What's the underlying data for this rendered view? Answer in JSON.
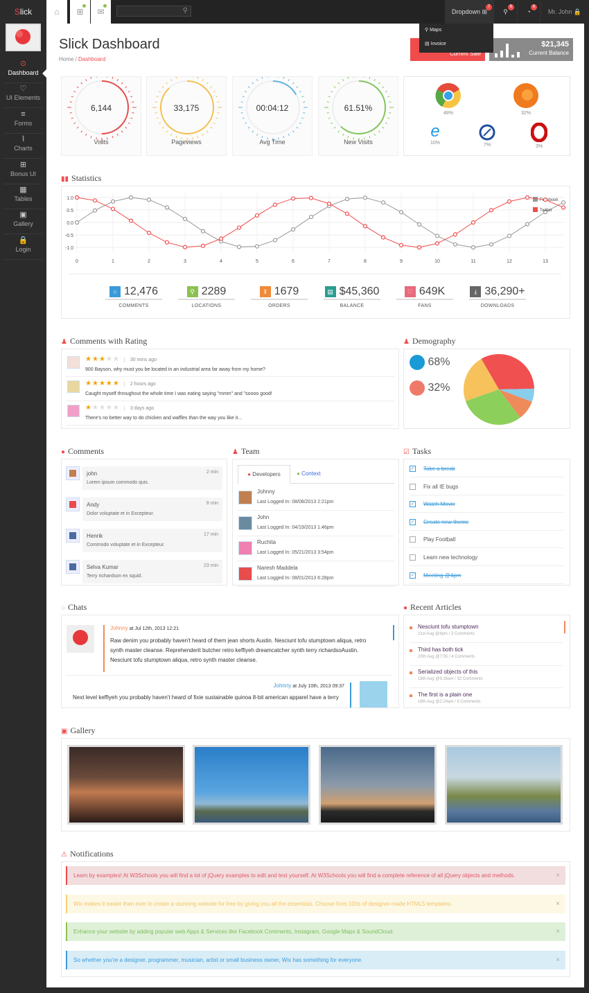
{
  "brand": {
    "first": "S",
    "rest": "lick"
  },
  "sidebar": {
    "items": [
      {
        "label": "Dashboard",
        "icon": "dashboard-icon",
        "glyph": "⊙"
      },
      {
        "label": "UI Elements",
        "icon": "heart-icon",
        "glyph": "♡"
      },
      {
        "label": "Forms",
        "icon": "list-icon",
        "glyph": "≡"
      },
      {
        "label": "Charts",
        "icon": "line-chart-icon",
        "glyph": "⌇"
      },
      {
        "label": "Bonus UI",
        "icon": "gift-icon",
        "glyph": "⊞"
      },
      {
        "label": "Tables",
        "icon": "table-icon",
        "glyph": "▦"
      },
      {
        "label": "Gallery",
        "icon": "image-icon",
        "glyph": "▣"
      },
      {
        "label": "Login",
        "icon": "lock-icon",
        "glyph": "🔒"
      }
    ]
  },
  "topbar": {
    "search_placeholder": "",
    "dropdown": "Dropdown",
    "dropdown_badge": "7",
    "map_badge": "6",
    "clock_badge": "6",
    "user": "Mr. John",
    "menu": [
      {
        "label": "Maps",
        "icon": "map-marker-icon"
      },
      {
        "label": "Invoice",
        "icon": "invoice-icon"
      }
    ]
  },
  "header": {
    "title": "Slick Dashboard",
    "breadcrumb": [
      "Home",
      "Dashboard"
    ],
    "sale": {
      "label": "Current Sale"
    },
    "balance": {
      "value": "$21,345",
      "label": "Current Balance"
    }
  },
  "gauges": [
    {
      "value": "6,144",
      "label": "Visits",
      "fill": 0.5,
      "color": "#e84c4c"
    },
    {
      "value": "33,175",
      "label": "Pageviews",
      "fill": 0.88,
      "color": "#f5bf4f"
    },
    {
      "value": "00:04:12",
      "label": "Avg Time",
      "fill": 0.17,
      "color": "#5fb4de"
    },
    {
      "value": "61.51%",
      "label": "New Visits",
      "fill": 0.62,
      "color": "#7fc65a"
    }
  ],
  "browsers": [
    {
      "name": "chrome-icon",
      "pct": "48%"
    },
    {
      "name": "firefox-icon",
      "pct": "32%"
    },
    {
      "name": "ie-icon",
      "pct": "10%"
    },
    {
      "name": "safari-icon",
      "pct": "7%"
    },
    {
      "name": "opera-icon",
      "pct": "3%"
    }
  ],
  "statistics": {
    "title": "Statistics",
    "chart_data": {
      "type": "line",
      "x": [
        0,
        0.5,
        1,
        1.5,
        2,
        2.5,
        3,
        3.5,
        4,
        4.5,
        5,
        5.5,
        6,
        6.5,
        7,
        7.5,
        8,
        8.5,
        9,
        9.5,
        10,
        10.5,
        11,
        11.5,
        12,
        12.5,
        13,
        13.5
      ],
      "series": [
        {
          "name": "Facebook",
          "color": "#999999",
          "values": [
            0,
            0.48,
            0.84,
            1.0,
            0.91,
            0.6,
            0.14,
            -0.35,
            -0.76,
            -0.98,
            -0.96,
            -0.71,
            -0.28,
            0.22,
            0.66,
            0.94,
            0.99,
            0.8,
            0.41,
            -0.08,
            -0.54,
            -0.88,
            -1.0,
            -0.88,
            -0.54,
            -0.07,
            0.42,
            0.8
          ]
        },
        {
          "name": "Twitter",
          "color": "#f04c4c",
          "values": [
            1.0,
            0.88,
            0.54,
            0.07,
            -0.42,
            -0.8,
            -0.99,
            -0.94,
            -0.65,
            -0.21,
            0.28,
            0.71,
            0.96,
            0.98,
            0.75,
            0.35,
            -0.15,
            -0.6,
            -0.91,
            -1.0,
            -0.84,
            -0.48,
            0.0,
            0.49,
            0.84,
            1.0,
            0.91,
            0.6
          ]
        }
      ],
      "xticks": [
        "0",
        "1",
        "2",
        "3",
        "4",
        "5",
        "6",
        "7",
        "8",
        "9",
        "10",
        "11",
        "12",
        "13"
      ],
      "yticks": [
        "1.0",
        "0.5",
        "0.0",
        "-0.5",
        "-1.0"
      ],
      "ylim": [
        -1,
        1
      ],
      "xlim": [
        0,
        13.5
      ],
      "grid": true,
      "legend": "top-right"
    },
    "counters": [
      {
        "value": "12,476",
        "label": "COMMENTS",
        "color": "#3a9ad9",
        "icon": "comment-icon",
        "glyph": "○"
      },
      {
        "value": "2289",
        "label": "LOCATIONS",
        "color": "#8cc152",
        "icon": "map-marker-icon",
        "glyph": "⚲"
      },
      {
        "value": "1679",
        "label": "ORDERS",
        "color": "#ef8a3a",
        "icon": "cutlery-icon",
        "glyph": "ǁ"
      },
      {
        "value": "$45,360",
        "label": "BALANCE",
        "color": "#2a9d8f",
        "icon": "briefcase-icon",
        "glyph": "▤"
      },
      {
        "value": "649K",
        "label": "FANS",
        "color": "#e86a7a",
        "icon": "heart-icon",
        "glyph": "♡"
      },
      {
        "value": "36,290+",
        "label": "DOWNLOADS",
        "color": "#666666",
        "icon": "download-icon",
        "glyph": "⤓"
      }
    ]
  },
  "rating": {
    "title": "Comments with Rating",
    "items": [
      {
        "stars": 3,
        "time": "30 mins ago",
        "text": "900 Bayson, why must you be located in an industrial area far away from my home?"
      },
      {
        "stars": 5,
        "time": "2 hours ago",
        "text": "Caught myself throughout the whole time I was eating saying \"mmm\" and \"soooo good!"
      },
      {
        "stars": 1,
        "time": "3 days ago",
        "text": "There's no better way to do chicken and waffles than the way you like it..."
      }
    ]
  },
  "demography": {
    "title": "Demography",
    "male": "68%",
    "female": "32%",
    "pie": [
      {
        "value": 33,
        "color": "#f05050"
      },
      {
        "value": 6,
        "color": "#87ceeb"
      },
      {
        "value": 9,
        "color": "#ef8a5a"
      },
      {
        "value": 30,
        "color": "#8ccf5a"
      },
      {
        "value": 22,
        "color": "#f7c25c"
      }
    ]
  },
  "comments": {
    "title": "Comments",
    "items": [
      {
        "name": "john",
        "time": "2 min",
        "text": "Lorem ipsum commodo quis."
      },
      {
        "name": "Andy",
        "time": "8 min",
        "text": "Dolor voluptate et in Excepteur."
      },
      {
        "name": "Henrik",
        "time": "17 min",
        "text": "Commodo voluptate et in Excepteur."
      },
      {
        "name": "Selva Kumar",
        "time": "23 min",
        "text": "Terry richardson ex squid."
      }
    ]
  },
  "team": {
    "title": "Team",
    "tabs": [
      "Developers",
      "Context"
    ],
    "members": [
      {
        "name": "Johnny",
        "login": "Last Logged In: 08/08/2013 2:21pm"
      },
      {
        "name": "John",
        "login": "Last Logged In: 04/19/2013 1:46pm"
      },
      {
        "name": "Ruchita",
        "login": "Last Logged In: 05/21/2013 3:54pm"
      },
      {
        "name": "Naresh Maddela",
        "login": "Last Logged In: 08/01/2013 6:28pm"
      }
    ]
  },
  "tasks": {
    "title": "Tasks",
    "items": [
      {
        "label": "Take a break",
        "done": true
      },
      {
        "label": "Fix all IE bugs",
        "done": false
      },
      {
        "label": "Watch Movie",
        "done": true
      },
      {
        "label": "Create new theme",
        "done": true
      },
      {
        "label": "Play Football",
        "done": false
      },
      {
        "label": "Learn new technology",
        "done": false
      },
      {
        "label": "Meeting @4pm",
        "done": true
      }
    ]
  },
  "chats": {
    "title": "Chats",
    "items": [
      {
        "name": "Johnny",
        "at": "at Jul 12th, 2013 12:21",
        "text": "Raw denim you probably haven't heard of them jean shorts Austin. Nesciunt tofu stumptown aliqua, retro synth master cleanse. Reprehenderit butcher retro keffiyeh dreamcatcher synth terry richardsoAustin. Nesciunt tofu stumptown aliqua, retro synth master cleanse."
      },
      {
        "name": "Johnny",
        "at": "at July 10th, 2013 09:37",
        "text": "Next level keffiyeh you probably haven't heard of fixie sustainable quinoa 8-bit american apparel have a terry"
      }
    ]
  },
  "articles": {
    "title": "Recent Articles",
    "items": [
      {
        "title": "Nesciunt tofu stumptown",
        "meta": "21st Aug @4pm / 3 Comments"
      },
      {
        "title": "Third has both tick",
        "meta": "20th Aug @7:55 / 4 Comments"
      },
      {
        "title": "Serialized objects of this",
        "meta": "18th Aug @9:26am / 32 Comments"
      },
      {
        "title": "The first is a plain one",
        "meta": "18th Aug @2:24am / 9 Comments"
      }
    ]
  },
  "gallery": {
    "title": "Gallery"
  },
  "notifications": {
    "title": "Notifications",
    "items": [
      {
        "text": "Learn by examples! At W3Schools you will find a lot of jQuery examples to edit and test yourself. At W3Schools you will find a complete reference of all jQuery objects and methods.",
        "bg": "#f2dede",
        "fg": "#e0566a",
        "bar": "#e84c4c"
      },
      {
        "text": "Wix makes it easier than ever to create a stunning website for free by giving you all the essentials. Choose from 100s of designer-made HTML5 templates.",
        "bg": "#fcf8e3",
        "fg": "#f5c26b",
        "bar": "#f7d070"
      },
      {
        "text": "Enhance your website by adding popular web Apps & Services like Facebook Comments, Instagram, Google Maps & SoundCloud.",
        "bg": "#dff0d8",
        "fg": "#7cbd5c",
        "bar": "#8cc152"
      },
      {
        "text": "So whether you're a designer, programmer, musician, artist or small business owner, Wix has something for everyone.",
        "bg": "#d9edf7",
        "fg": "#3a9ad9",
        "bar": "#3a9ad9"
      }
    ],
    "close": "×"
  }
}
